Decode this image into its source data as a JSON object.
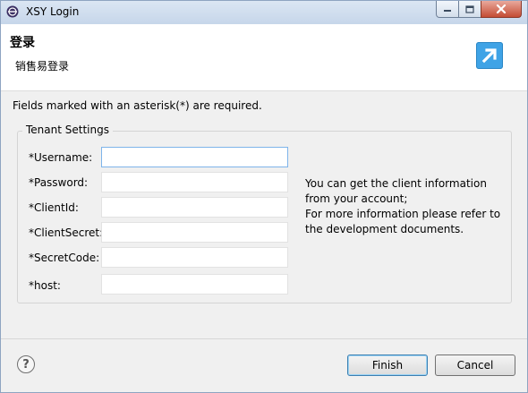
{
  "window": {
    "title": "XSY Login",
    "icon": "eclipse-app-icon"
  },
  "header": {
    "title": "登录",
    "description": "销售易登录",
    "icon": "wizard-arrow-icon",
    "icon_color": "#3fa3e6"
  },
  "required_note": "Fields marked with an asterisk(*) are required.",
  "group": {
    "title": "Tenant Settings",
    "fields": [
      {
        "label": "*Username:",
        "value": "",
        "focused": true
      },
      {
        "label": "*Password:",
        "value": ""
      },
      {
        "label": "*ClientId:",
        "value": ""
      },
      {
        "label": "*ClientSecret:",
        "value": ""
      },
      {
        "label": "*SecretCode:",
        "value": ""
      },
      {
        "label": "*host:",
        "value": ""
      }
    ]
  },
  "info": {
    "lines": [
      "You can get the client information",
      "from your account;",
      "For more information please refer to",
      "the development documents."
    ]
  },
  "footer": {
    "help_icon": "question-icon",
    "finish_label": "Finish",
    "cancel_label": "Cancel"
  }
}
